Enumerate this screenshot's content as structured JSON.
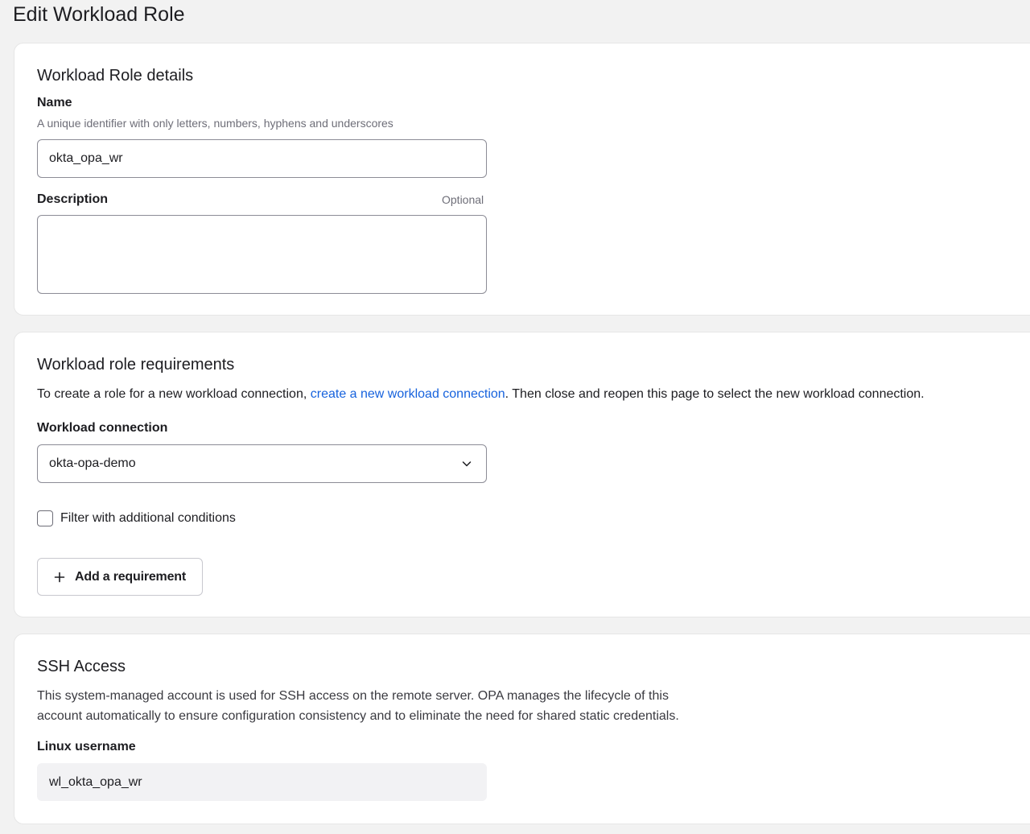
{
  "page": {
    "title": "Edit Workload Role"
  },
  "details": {
    "title": "Workload Role details",
    "name_label": "Name",
    "name_hint": "A unique identifier with only letters, numbers, hyphens and underscores",
    "name_value": "okta_opa_wr",
    "description_label": "Description",
    "description_optional": "Optional",
    "description_value": ""
  },
  "requirements": {
    "title": "Workload role requirements",
    "intro_before": "To create a role for a new workload connection, ",
    "intro_link": "create a new workload connection",
    "intro_after": ". Then close and reopen this page to select the new workload connection.",
    "connection_label": "Workload connection",
    "connection_value": "okta-opa-demo",
    "filter_label": "Filter with additional conditions",
    "add_button_label": "Add a requirement"
  },
  "ssh": {
    "title": "SSH Access",
    "description_line1": "This system-managed account is used for SSH access on the remote server. OPA manages the lifecycle of this",
    "description_line2": "account automatically to ensure configuration consistency and to eliminate the need for shared static credentials.",
    "username_label": "Linux username",
    "username_value": "wl_okta_opa_wr"
  },
  "icons": {
    "select": "chevron-down-icon",
    "add": "plus-icon"
  },
  "colors": {
    "link": "#1662dd",
    "background": "#f2f2f2",
    "card": "#ffffff"
  }
}
